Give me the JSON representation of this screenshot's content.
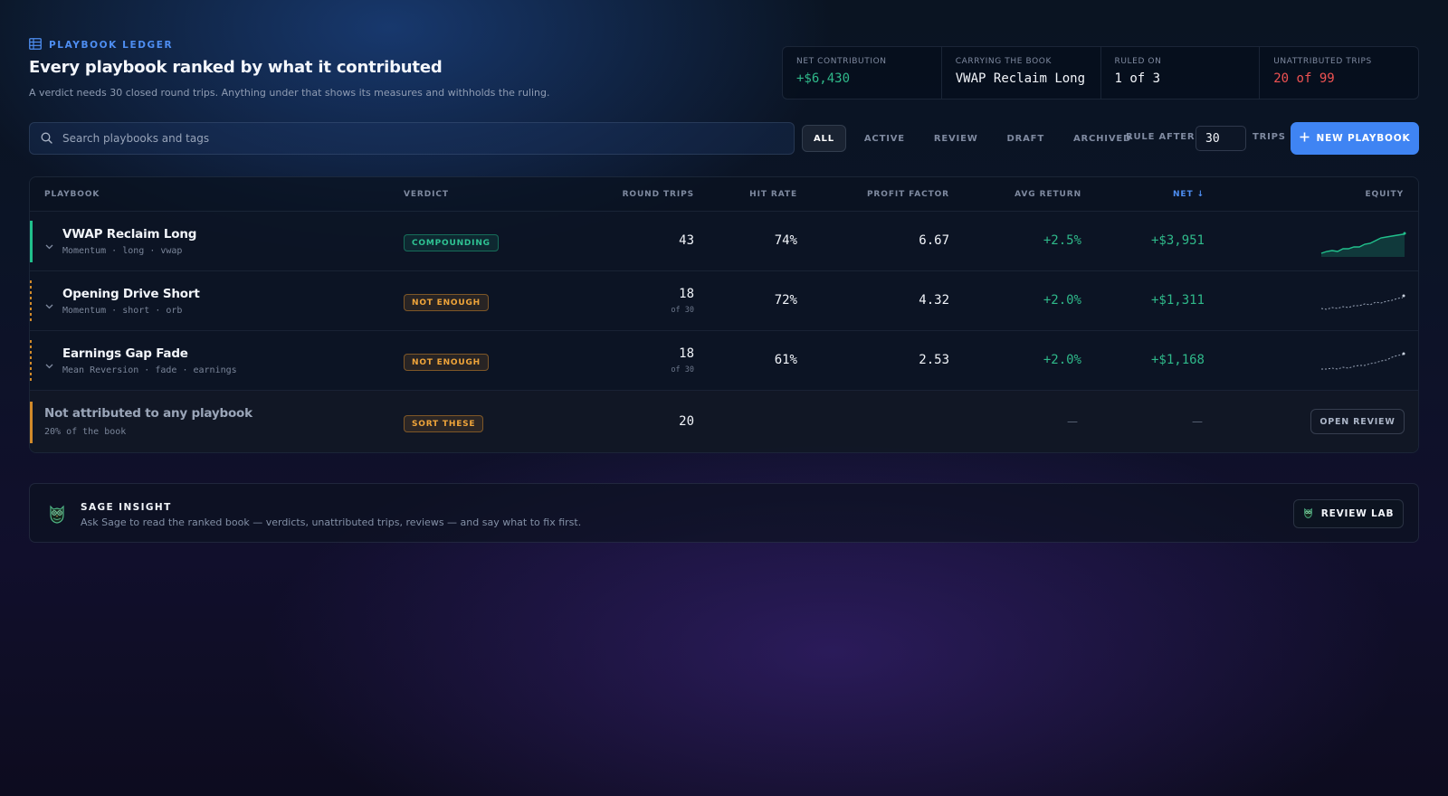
{
  "header": {
    "eyebrow": "PLAYBOOK LEDGER",
    "eyebrow_icon": "table-icon",
    "title": "Every playbook ranked by what it contributed",
    "subtitle": "A verdict needs 30 closed round trips. Anything under that shows its measures and withholds the ruling."
  },
  "stats": [
    {
      "label": "NET CONTRIBUTION",
      "value": "+$6,430",
      "tone": "green"
    },
    {
      "label": "CARRYING THE BOOK",
      "value": "VWAP Reclaim Long",
      "tone": "white"
    },
    {
      "label": "RULED ON",
      "value": "1 of 3",
      "tone": "white"
    },
    {
      "label": "UNATTRIBUTED TRIPS",
      "value": "20 of 99",
      "tone": "red"
    }
  ],
  "toolbar": {
    "search_placeholder": "Search playbooks and tags",
    "filters": [
      "ALL",
      "ACTIVE",
      "REVIEW",
      "DRAFT",
      "ARCHIVED"
    ],
    "active_filter": "ALL",
    "rule_label": "RULE AFTER",
    "rule_value": "30",
    "trips_label": "TRIPS",
    "new_button": "NEW PLAYBOOK"
  },
  "table": {
    "columns": {
      "playbook": "PLAYBOOK",
      "verdict": "VERDICT",
      "round_trips": "ROUND TRIPS",
      "hit_rate": "HIT RATE",
      "profit_factor": "PROFIT FACTOR",
      "avg_return": "AVG RETURN",
      "net": "NET ↓",
      "equity": "EQUITY"
    },
    "rows": [
      {
        "name": "VWAP Reclaim Long",
        "tags": "Momentum · long · vwap",
        "verdict": "COMPOUNDING",
        "verdict_tone": "green",
        "round_trips": "43",
        "round_trips_sub": "",
        "hit_rate": "74%",
        "profit_factor": "6.67",
        "avg_return": "+2.5%",
        "net": "+$3,951"
      },
      {
        "name": "Opening Drive Short",
        "tags": "Momentum · short · orb",
        "verdict": "NOT ENOUGH",
        "verdict_tone": "amber",
        "round_trips": "18",
        "round_trips_sub": "of 30",
        "hit_rate": "72%",
        "profit_factor": "4.32",
        "avg_return": "+2.0%",
        "net": "+$1,311"
      },
      {
        "name": "Earnings Gap Fade",
        "tags": "Mean Reversion · fade · earnings",
        "verdict": "NOT ENOUGH",
        "verdict_tone": "amber",
        "round_trips": "18",
        "round_trips_sub": "of 30",
        "hit_rate": "61%",
        "profit_factor": "2.53",
        "avg_return": "+2.0%",
        "net": "+$1,168"
      }
    ],
    "unattributed": {
      "name": "Not attributed to any playbook",
      "tags": "20% of the book",
      "verdict": "SORT THESE",
      "round_trips": "20",
      "avg_return": "—",
      "net": "—",
      "action": "OPEN REVIEW"
    }
  },
  "sage": {
    "icon": "owl-icon",
    "title": "SAGE INSIGHT",
    "description": "Ask Sage to read the ranked book — verdicts, unattributed trips, reviews — and say what to fix first.",
    "button": "REVIEW LAB"
  },
  "colors": {
    "accent": "#3f84f3",
    "positive": "#2fb98a",
    "negative": "#ef5252",
    "warning": "#f0a53a"
  }
}
